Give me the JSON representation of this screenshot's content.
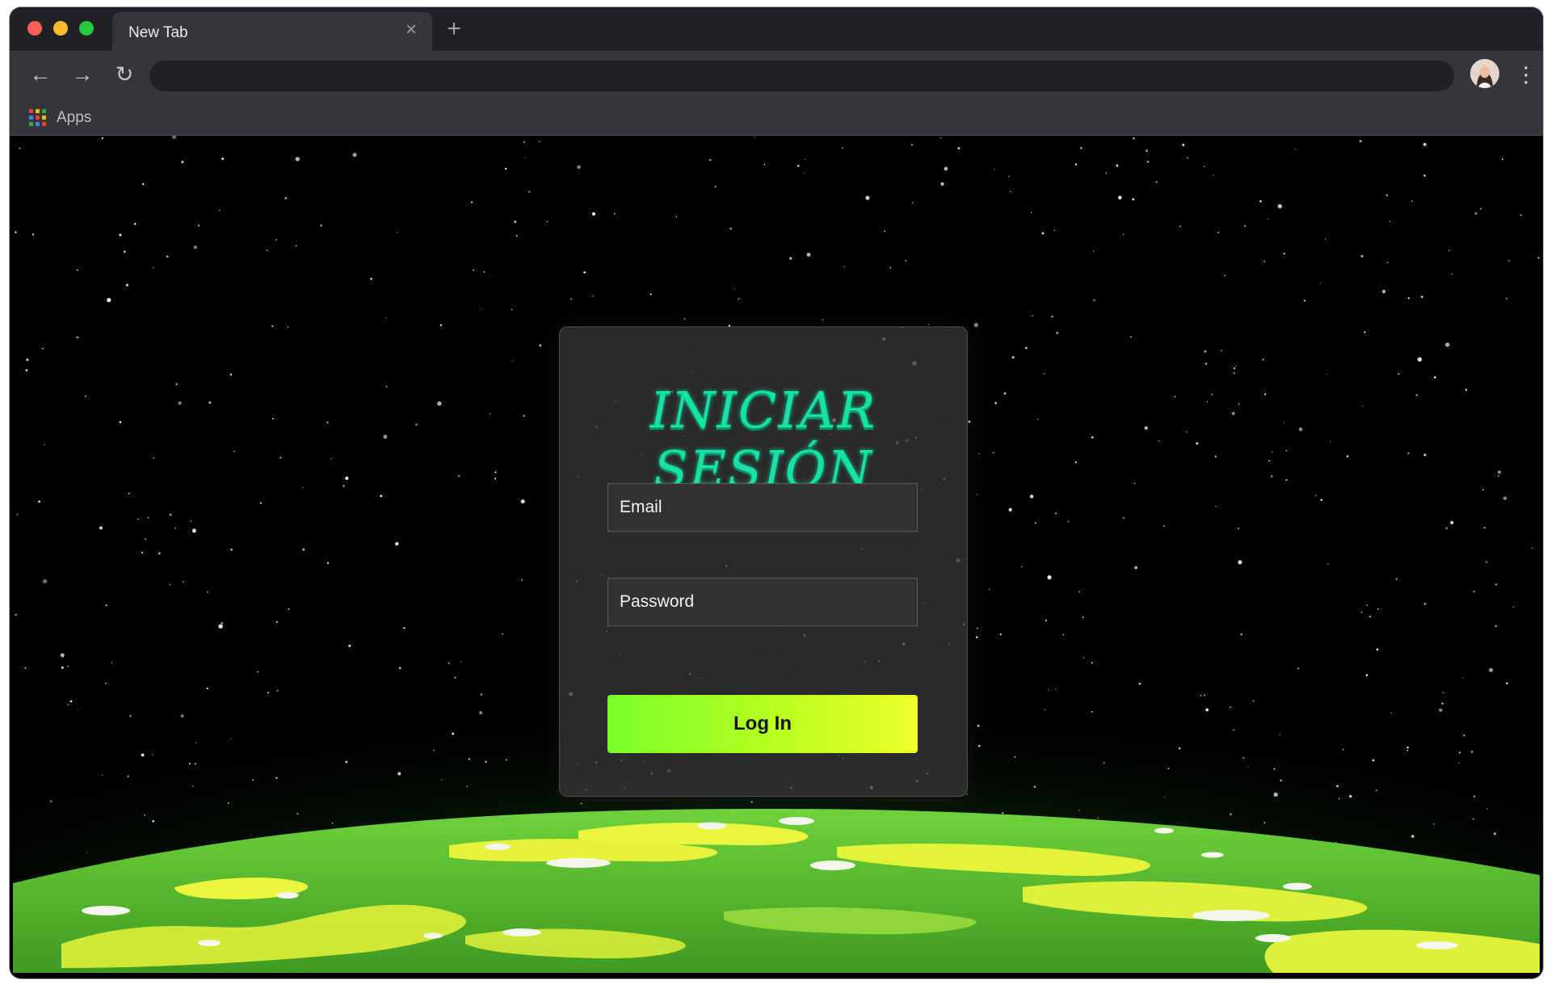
{
  "browser": {
    "tab": {
      "title": "New Tab"
    },
    "bookmarks": {
      "apps_label": "Apps"
    },
    "apps_grid_colors": [
      "#ea4335",
      "#fbbc05",
      "#34a853",
      "#4285f4",
      "#ea4335",
      "#fbbc05",
      "#34a853",
      "#4285f4",
      "#ea4335"
    ]
  },
  "login": {
    "title": "INICIAR SESIÓN",
    "email_placeholder": "Email",
    "password_placeholder": "Password",
    "button_label": "Log In"
  },
  "colors": {
    "title_accent": "#16e2a4",
    "button_gradient_start": "#78ff2a",
    "button_gradient_end": "#eeff2a",
    "planet_green": "#5cc22e",
    "planet_yellow": "#e3f23a"
  }
}
